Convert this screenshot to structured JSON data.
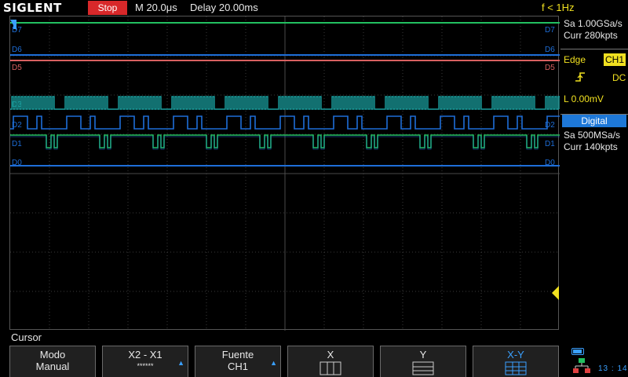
{
  "topbar": {
    "brand": "SIGLENT",
    "run_status": "Stop",
    "timebase": "M 20.0μs",
    "delay": "Delay 20.00ms",
    "frequency": "f < 1Hz"
  },
  "acquisition": {
    "sample_rate": "Sa 1.00GSa/s",
    "memory_depth": "Curr 280kpts"
  },
  "trigger": {
    "mode": "Edge",
    "source": "CH1",
    "coupling": "DC",
    "level": "L  0.00mV"
  },
  "digital": {
    "label": "Digital",
    "sample_rate": "Sa 500MSa/s",
    "memory_depth": "Curr 140kpts"
  },
  "channels": {
    "d7": "D7",
    "d6": "D6",
    "d5": "D5",
    "d3": "D3",
    "d2": "D2",
    "d1": "D1",
    "d0": "D0"
  },
  "menu": {
    "title": "Cursor",
    "keys": [
      {
        "line1": "Modo",
        "line2": "Manual"
      },
      {
        "line1": "X2 - X1",
        "line2": "******"
      },
      {
        "line1": "Fuente",
        "line2": "CH1"
      },
      {
        "line1": "X"
      },
      {
        "line1": "Y"
      },
      {
        "line1": "X-Y"
      }
    ]
  },
  "status": {
    "clock": "13 : 14"
  },
  "colors": {
    "green": "#22c060",
    "blue": "#1e6ed8",
    "red": "#d86060",
    "teal": "#1aa0a0",
    "yellow": "#f0e020",
    "accent": "#3aa0ff",
    "grid": "#3a3a3a"
  }
}
